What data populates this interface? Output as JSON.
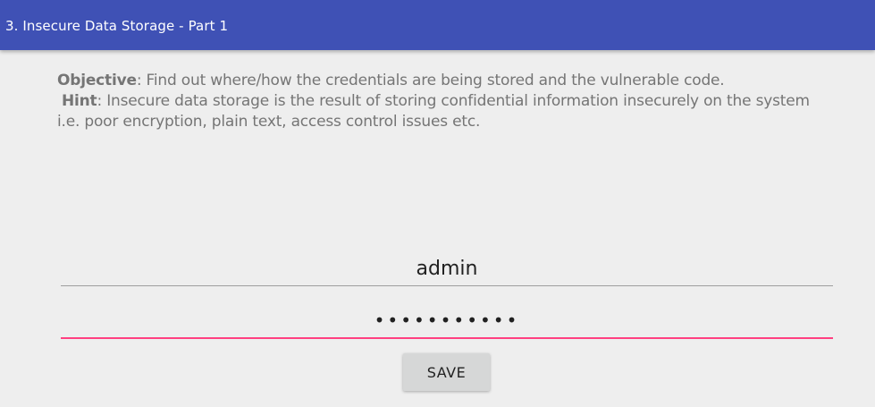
{
  "app_bar": {
    "title": "3. Insecure Data Storage - Part 1"
  },
  "instructions": {
    "objective_label": "Objective",
    "objective_text": ": Find out where/how the credentials are being stored and the vulnerable code.",
    "hint_label": "Hint",
    "hint_text_line1": ": Insecure data storage is the result of storing confidential information insecurely on the system",
    "hint_text_line2": "i.e. poor encryption, plain text, access control issues etc."
  },
  "form": {
    "username_value": "admin",
    "password_masked": "•••••••••••",
    "save_label": "SAVE"
  },
  "colors": {
    "brand": "#3f51b5",
    "accent": "#ff4081",
    "background": "#eeeeee"
  }
}
